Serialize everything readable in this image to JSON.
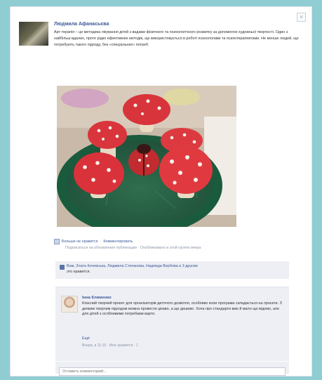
{
  "colors": {
    "page_bg": "#8fcdd3",
    "card_bg": "#ffffff",
    "link": "#3b5998",
    "meta": "#8b96ab",
    "panel": "#edeff4"
  },
  "post": {
    "close_label": "×",
    "author": "Людмила Афанасьєва",
    "text": "Арт-терапія – це методика лікування дітей з вадами фізичного та психологічного розвитку за допомогою художньої творчості. Один з найбільш вдалих, проте рідко ефективних методів, що використовується в роботі психологами та психотерапевтами. Не менше людей, що потребують такого підходу, без «спеціальних» потреб.",
    "photo_alt": "Мухомори з пластиліну"
  },
  "meta": {
    "like": "Больше не нравится",
    "comment": "Комментировать",
    "line2": "Подписаться на обновления публикации · Опубликовано в этой группе вчера"
  },
  "likes": {
    "names": "Вам, Злата Кочевська, Людмила Степанова, Надежда Вербова и 3 другим",
    "suffix": "это нравится."
  },
  "comment": {
    "author": "Інна Клименко",
    "text": "Класний творчий проект для організаторів дитячого дозвілля, особливо коли програма складається на проєкти. З деяким творчим підходом можна провести цікаво, а ще дешево. Хоча про стандарти вже й мало що відомо, але для дітей з особливими потребами варто.",
    "more": "Ещё",
    "meta": "Вчера, в 11:15 · Мне нравится · 1"
  },
  "write": {
    "placeholder": "Оставить комментарий..."
  }
}
